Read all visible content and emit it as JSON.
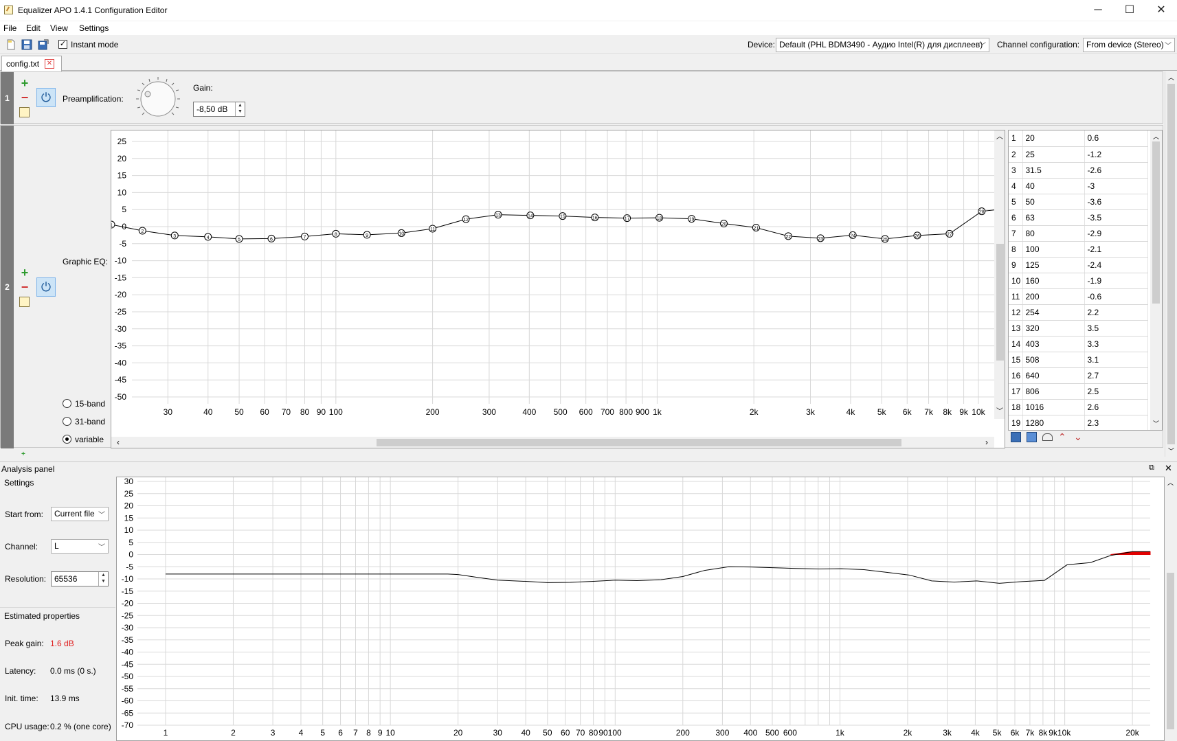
{
  "window": {
    "title": "Equalizer APO 1.4.1 Configuration Editor",
    "minimize": "─",
    "maximize": "☐",
    "close": "✕"
  },
  "menu": [
    "File",
    "Edit",
    "View",
    "Settings"
  ],
  "toolbar": {
    "instant_mode_label": "Instant mode",
    "instant_mode_checked": "✓",
    "device_label": "Device:",
    "device_value": "Default (PHL BDM3490 - Аудио Intel(R) для дисплеев)",
    "channel_config_label": "Channel configuration:",
    "channel_config_value": "From device (Stereo)"
  },
  "tabs": [
    {
      "label": "config.txt",
      "close": "✕"
    }
  ],
  "filters": {
    "preamp": {
      "index": "1",
      "label": "Preamplification:",
      "gain_label": "Gain:",
      "gain_value": "-8,50 dB"
    },
    "geq": {
      "index": "2",
      "label": "Graphic EQ:",
      "modes": [
        "15-band",
        "31-band",
        "variable"
      ],
      "selected_mode": "variable"
    }
  },
  "geq_graph": {
    "y_ticks": [
      "25",
      "20",
      "15",
      "10",
      "5",
      "0",
      "-5",
      "-10",
      "-15",
      "-20",
      "-25",
      "-30",
      "-35",
      "-40",
      "-45",
      "-50"
    ],
    "x_ticks": [
      "30",
      "40",
      "50",
      "60",
      "70",
      "80",
      "90",
      "100",
      "200",
      "300",
      "400",
      "500",
      "600",
      "700",
      "800",
      "900",
      "1k",
      "2k",
      "3k",
      "4k",
      "5k",
      "6k",
      "7k",
      "8k",
      "9k",
      "10k"
    ],
    "bands": [
      {
        "n": "1",
        "f": 20,
        "g": 0.6
      },
      {
        "n": "2",
        "f": 25,
        "g": -1.2
      },
      {
        "n": "3",
        "f": 31.5,
        "g": -2.6
      },
      {
        "n": "4",
        "f": 40,
        "g": -3
      },
      {
        "n": "5",
        "f": 50,
        "g": -3.6
      },
      {
        "n": "6",
        "f": 63,
        "g": -3.5
      },
      {
        "n": "7",
        "f": 80,
        "g": -2.9
      },
      {
        "n": "8",
        "f": 100,
        "g": -2.1
      },
      {
        "n": "9",
        "f": 125,
        "g": -2.4
      },
      {
        "n": "10",
        "f": 160,
        "g": -1.9
      },
      {
        "n": "11",
        "f": 200,
        "g": -0.6
      },
      {
        "n": "12",
        "f": 254,
        "g": 2.2
      },
      {
        "n": "13",
        "f": 320,
        "g": 3.5
      },
      {
        "n": "14",
        "f": 403,
        "g": 3.3
      },
      {
        "n": "15",
        "f": 508,
        "g": 3.1
      },
      {
        "n": "16",
        "f": 640,
        "g": 2.7
      },
      {
        "n": "17",
        "f": 806,
        "g": 2.5
      },
      {
        "n": "18",
        "f": 1016,
        "g": 2.6
      },
      {
        "n": "19",
        "f": 1280,
        "g": 2.3
      },
      {
        "n": "20",
        "f": 1613,
        "g": 0.9
      },
      {
        "n": "21",
        "f": 2032,
        "g": -0.3
      },
      {
        "n": "22",
        "f": 2560,
        "g": -2.8
      },
      {
        "n": "23",
        "f": 3225,
        "g": -3.4
      },
      {
        "n": "24",
        "f": 4064,
        "g": -2.5
      },
      {
        "n": "25",
        "f": 5120,
        "g": -3.6
      },
      {
        "n": "26",
        "f": 6451,
        "g": -2.6
      },
      {
        "n": "27",
        "f": 8127,
        "g": -2.1
      },
      {
        "n": "28",
        "f": 10240,
        "g": 4.5
      }
    ]
  },
  "band_table": [
    [
      "1",
      "20",
      "0.6"
    ],
    [
      "2",
      "25",
      "-1.2"
    ],
    [
      "3",
      "31.5",
      "-2.6"
    ],
    [
      "4",
      "40",
      "-3"
    ],
    [
      "5",
      "50",
      "-3.6"
    ],
    [
      "6",
      "63",
      "-3.5"
    ],
    [
      "7",
      "80",
      "-2.9"
    ],
    [
      "8",
      "100",
      "-2.1"
    ],
    [
      "9",
      "125",
      "-2.4"
    ],
    [
      "10",
      "160",
      "-1.9"
    ],
    [
      "11",
      "200",
      "-0.6"
    ],
    [
      "12",
      "254",
      "2.2"
    ],
    [
      "13",
      "320",
      "3.5"
    ],
    [
      "14",
      "403",
      "3.3"
    ],
    [
      "15",
      "508",
      "3.1"
    ],
    [
      "16",
      "640",
      "2.7"
    ],
    [
      "17",
      "806",
      "2.5"
    ],
    [
      "18",
      "1016",
      "2.6"
    ],
    [
      "19",
      "1280",
      "2.3"
    ]
  ],
  "analysis": {
    "title": "Analysis panel",
    "settings_title": "Settings",
    "start_from_label": "Start from:",
    "start_from_value": "Current file",
    "channel_label": "Channel:",
    "channel_value": "L",
    "resolution_label": "Resolution:",
    "resolution_value": "65536",
    "estimated_title": "Estimated properties",
    "peak_gain_label": "Peak gain:",
    "peak_gain_value": "1.6 dB",
    "latency_label": "Latency:",
    "latency_value": "0.0 ms (0 s.)",
    "init_time_label": "Init. time:",
    "init_time_value": "13.9 ms",
    "cpu_label": "CPU usage:",
    "cpu_value": "0.2 % (one core)",
    "y_ticks": [
      "30",
      "25",
      "20",
      "15",
      "10",
      "5",
      "0",
      "-5",
      "-10",
      "-15",
      "-20",
      "-25",
      "-30",
      "-35",
      "-40",
      "-45",
      "-50",
      "-55",
      "-60",
      "-65",
      "-70"
    ],
    "x_ticks": [
      "1",
      "2",
      "3",
      "4",
      "5",
      "6",
      "7",
      "8",
      "9",
      "10",
      "20",
      "30",
      "40",
      "50",
      "60",
      "70",
      "80",
      "90100",
      "200",
      "300",
      "400",
      "500",
      "600",
      "1k",
      "2k",
      "3k",
      "4k",
      "5k",
      "6k",
      "7k",
      "8k",
      "9k10k",
      "20k"
    ],
    "response": [
      [
        1,
        -8
      ],
      [
        10,
        -8
      ],
      [
        18,
        -8
      ],
      [
        20,
        -8.2
      ],
      [
        25,
        -9.5
      ],
      [
        30,
        -10.5
      ],
      [
        40,
        -11
      ],
      [
        50,
        -11.5
      ],
      [
        63,
        -11.4
      ],
      [
        80,
        -11
      ],
      [
        100,
        -10.5
      ],
      [
        125,
        -10.7
      ],
      [
        160,
        -10.3
      ],
      [
        200,
        -9
      ],
      [
        250,
        -6.5
      ],
      [
        320,
        -5
      ],
      [
        400,
        -5.1
      ],
      [
        500,
        -5.4
      ],
      [
        640,
        -5.7
      ],
      [
        806,
        -5.9
      ],
      [
        1016,
        -5.8
      ],
      [
        1280,
        -6.2
      ],
      [
        1613,
        -7.3
      ],
      [
        2032,
        -8.4
      ],
      [
        2560,
        -10.8
      ],
      [
        3225,
        -11.3
      ],
      [
        4064,
        -10.8
      ],
      [
        5120,
        -11.8
      ],
      [
        6451,
        -11.1
      ],
      [
        8127,
        -10.6
      ],
      [
        10240,
        -4.2
      ],
      [
        13000,
        -3.3
      ],
      [
        16000,
        -0.4
      ],
      [
        20000,
        1.2
      ],
      [
        22000,
        1.2
      ],
      [
        24000,
        1.2
      ]
    ],
    "peak_color": "#e00000"
  }
}
